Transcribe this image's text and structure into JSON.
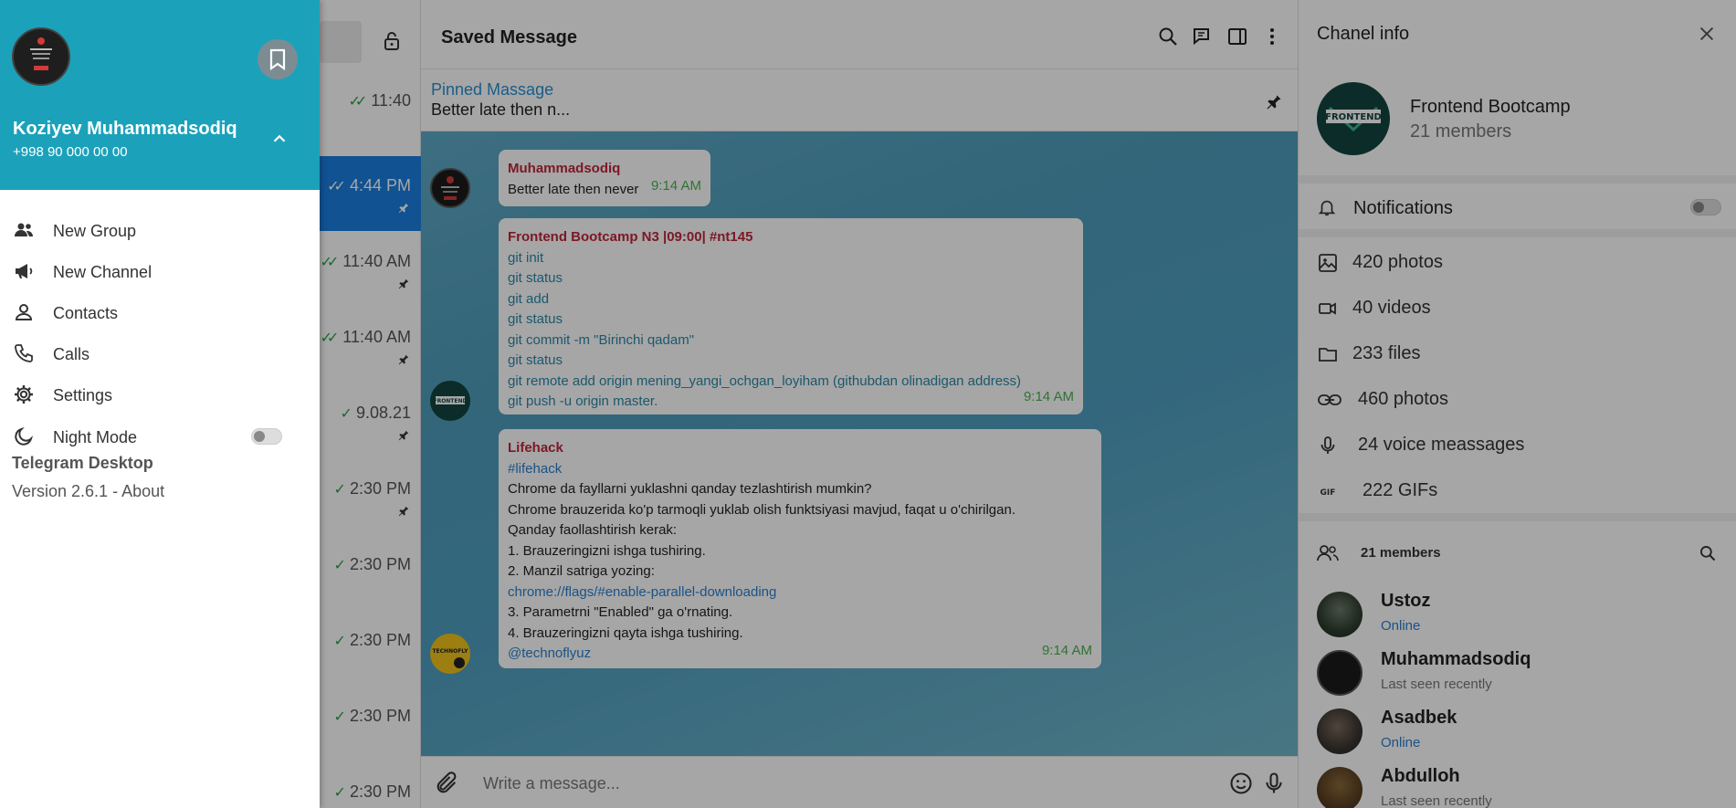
{
  "chat_list": {
    "items": [
      {
        "time": "11:40",
        "pinned": false,
        "active": false
      },
      {
        "time": "4:44 PM",
        "pinned": true,
        "active": true
      },
      {
        "time": "11:40 AM",
        "pinned": true,
        "active": false
      },
      {
        "time": "11:40 AM",
        "pinned": true,
        "active": false
      },
      {
        "time": "9.08.21",
        "pinned": true,
        "active": false
      },
      {
        "time": "2:30 PM",
        "pinned": true,
        "active": false
      },
      {
        "time": "2:30 PM",
        "pinned": false,
        "active": false
      },
      {
        "time": "2:30 PM",
        "pinned": false,
        "active": false
      },
      {
        "time": "2:30 PM",
        "pinned": false,
        "active": false
      },
      {
        "time": "2:30 PM",
        "pinned": false,
        "active": false
      }
    ]
  },
  "chat": {
    "title": "Saved Message",
    "pinned_label": "Pinned Massage",
    "pinned_text": "Better late then n...",
    "messages": [
      {
        "author": "Muhammadsodiq",
        "lines": [
          "Better late then never"
        ],
        "time": "9:14 AM"
      },
      {
        "author": "Frontend Bootcamp N3 |09:00| #nt145",
        "lines": [
          "git init",
          "git status",
          "git add",
          "git status",
          "git commit -m \"Birinchi qadam\"",
          "git status",
          "git remote add origin mening_yangi_ochgan_loyiham (githubdan olinadigan address)",
          "git push -u origin master."
        ],
        "time": "9:14 AM"
      },
      {
        "author": "Lifehack",
        "lines": [
          "#lifehack",
          "Chrome da fayllarni yuklashni qanday tezlashtirish mumkin?",
          "Chrome brauzerida ko'p tarmoqli yuklab olish funktsiyasi mavjud, faqat u o'chirilgan.",
          "Qanday faollashtirish kerak:",
          "1. Brauzeringizni ishga tushiring.",
          "2. Manzil satriga yozing:",
          "chrome://flags/#enable-parallel-downloading",
          "3. Parametrni \"Enabled\" ga o'rnating.",
          "4. Brauzeringizni qayta ishga tushiring.",
          "@technoflyuz"
        ],
        "time": "9:14 AM"
      }
    ],
    "composer_placeholder": "Write a message..."
  },
  "info": {
    "title": "Chanel info",
    "channel_name": "Frontend Bootcamp",
    "channel_members": "21 members",
    "channel_logo_text": "FRONTEND",
    "notifications_label": "Notifications",
    "notifications_on": false,
    "media": [
      {
        "icon": "image-icon",
        "label": "420 photos"
      },
      {
        "icon": "video-icon",
        "label": "40 videos"
      },
      {
        "icon": "folder-icon",
        "label": "233 files"
      },
      {
        "icon": "link-icon",
        "label": "460 photos"
      },
      {
        "icon": "microphone-icon",
        "label": "24 voice meassages"
      },
      {
        "icon": "gif-icon",
        "label": "222 GIFs"
      }
    ],
    "members_header": "21 members",
    "members": [
      {
        "name": "Ustoz",
        "status": "Online",
        "online": true
      },
      {
        "name": "Muhammadsodiq",
        "status": "Last seen recently",
        "online": false
      },
      {
        "name": "Asadbek",
        "status": "Online",
        "online": true
      },
      {
        "name": "Abdulloh",
        "status": "Last seen recently",
        "online": false
      }
    ]
  },
  "side_menu": {
    "user_name": "Koziyev Muhammadsodiq",
    "user_phone": "+998 90 000 00 00",
    "items": [
      {
        "icon": "group-icon",
        "label": "New Group"
      },
      {
        "icon": "megaphone-icon",
        "label": "New Channel"
      },
      {
        "icon": "person-icon",
        "label": "Contacts"
      },
      {
        "icon": "phone-icon",
        "label": "Calls"
      },
      {
        "icon": "gear-icon",
        "label": "Settings"
      },
      {
        "icon": "moon-icon",
        "label": "Night Mode"
      }
    ],
    "night_mode_on": false,
    "app_name": "Telegram Desktop",
    "version_label": "Version 2.6.1 -",
    "about_label": "About"
  },
  "colors": {
    "menu_header": "#1ba2ba",
    "accent_blue": "#2a7fd0",
    "active_chat": "#1a7fe0",
    "author_red": "#c0263a",
    "time_green": "#4caf50"
  }
}
